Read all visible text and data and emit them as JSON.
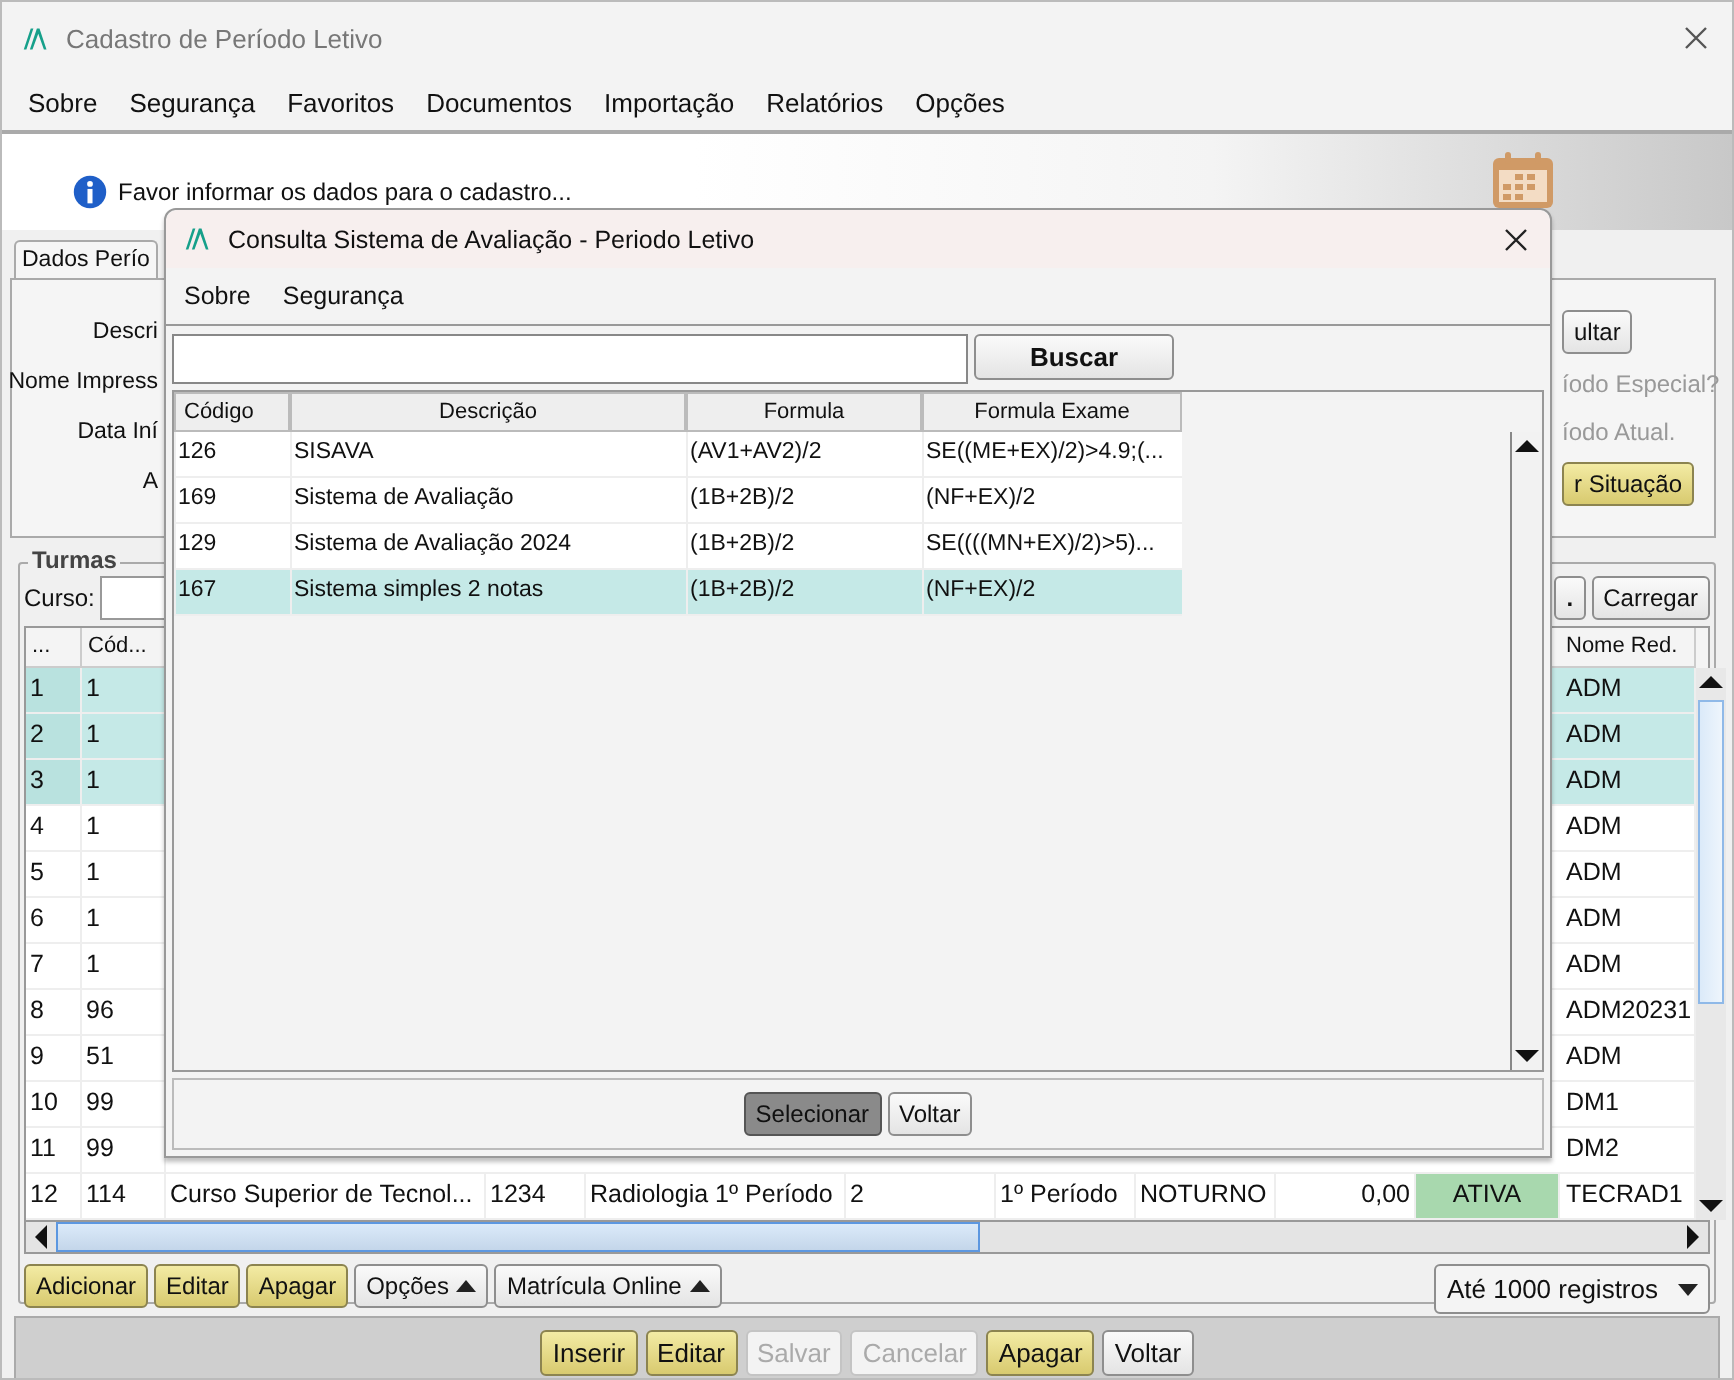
{
  "window": {
    "title": "Cadastro de Período Letivo"
  },
  "menu": [
    {
      "label": "Sobre"
    },
    {
      "label": "Segurança"
    },
    {
      "label": "Favoritos"
    },
    {
      "label": "Documentos"
    },
    {
      "label": "Importação"
    },
    {
      "label": "Relatórios"
    },
    {
      "label": "Opções"
    }
  ],
  "info_message": "Favor informar os dados para o cadastro...",
  "tabs": [
    {
      "label": "Dados Perío",
      "selected": true
    }
  ],
  "form": {
    "labels": [
      "Descri",
      "Nome Impress",
      "Data Iní",
      "A"
    ],
    "consult_button": "ultar",
    "special_period_label": "íodo Especial?",
    "current_period_label": "íodo Atual.",
    "situation_button": "r Situação"
  },
  "turmas": {
    "title": "Turmas",
    "course_label": "Curso:",
    "more_button": ".",
    "load_button": "Carregar",
    "columns": [
      "...",
      "Cód..."
    ],
    "last_column": "Nome Red.",
    "rows": [
      {
        "num": "1",
        "code": "1",
        "short_name": "ADM",
        "selected": true
      },
      {
        "num": "2",
        "code": "1",
        "short_name": "ADM",
        "selected": true
      },
      {
        "num": "3",
        "code": "1",
        "short_name": "ADM",
        "selected": true
      },
      {
        "num": "4",
        "code": "1",
        "short_name": "ADM",
        "selected": false
      },
      {
        "num": "5",
        "code": "1",
        "short_name": "ADM",
        "selected": false
      },
      {
        "num": "6",
        "code": "1",
        "short_name": "ADM",
        "selected": false
      },
      {
        "num": "7",
        "code": "1",
        "short_name": "ADM",
        "selected": false
      },
      {
        "num": "8",
        "code": "96",
        "short_name": "ADM20231",
        "selected": false
      },
      {
        "num": "9",
        "code": "51",
        "short_name": "ADM",
        "selected": false
      },
      {
        "num": "10",
        "code": "99",
        "short_name": "DM1",
        "selected": false
      },
      {
        "num": "11",
        "code": "99",
        "short_name": "DM2",
        "selected": false
      },
      {
        "num": "12",
        "code": "114",
        "short_name": "TECRAD1",
        "selected": false,
        "details": [
          "Curso Superior de Tecnol...",
          "1234",
          "Radiologia 1º Período",
          "2",
          "1º Período",
          "NOTURNO",
          "0,00"
        ],
        "status": {
          "label": "ATIVA",
          "color": "#a8d8ae"
        }
      }
    ],
    "actions": [
      {
        "label": "Adicionar",
        "kind": "button",
        "highlighted": true
      },
      {
        "label": "Editar",
        "kind": "button",
        "highlighted": true
      },
      {
        "label": "Apagar",
        "kind": "button",
        "highlighted": true
      },
      {
        "label": "Opções",
        "kind": "menu",
        "highlighted": false
      },
      {
        "label": "Matrícula Online",
        "kind": "menu",
        "highlighted": false
      }
    ],
    "limit_select": "Até 1000 registros"
  },
  "bottom_buttons": [
    {
      "label": "Inserir",
      "highlighted": true,
      "disabled": false
    },
    {
      "label": "Editar",
      "highlighted": true,
      "disabled": false
    },
    {
      "label": "Salvar",
      "highlighted": false,
      "disabled": true
    },
    {
      "label": "Cancelar",
      "highlighted": false,
      "disabled": true
    },
    {
      "label": "Apagar",
      "highlighted": true,
      "disabled": false
    },
    {
      "label": "Voltar",
      "highlighted": false,
      "disabled": false
    }
  ],
  "dialog": {
    "title": "Consulta Sistema de Avaliação - Periodo Letivo",
    "menu": [
      {
        "label": "Sobre"
      },
      {
        "label": "Segurança"
      }
    ],
    "search_button": "Buscar",
    "columns": [
      "Código",
      "Descrição",
      "Formula",
      "Formula Exame"
    ],
    "rows": [
      {
        "cells": [
          "126",
          "SISAVA",
          "(AV1+AV2)/2",
          "SE((ME+EX)/2)>4.9;(..."
        ],
        "selected": false
      },
      {
        "cells": [
          "169",
          "Sistema de Avaliação",
          "(1B+2B)/2",
          "(NF+EX)/2"
        ],
        "selected": false
      },
      {
        "cells": [
          "129",
          "Sistema de Avaliação 2024",
          "(1B+2B)/2",
          "SE((((MN+EX)/2)>5)..."
        ],
        "selected": false
      },
      {
        "cells": [
          "167",
          "Sistema simples 2 notas",
          "(1B+2B)/2",
          "(NF+EX)/2"
        ],
        "selected": true
      }
    ],
    "buttons": [
      {
        "label": "Selecionar",
        "pressed": true
      },
      {
        "label": "Voltar",
        "pressed": false
      }
    ]
  }
}
